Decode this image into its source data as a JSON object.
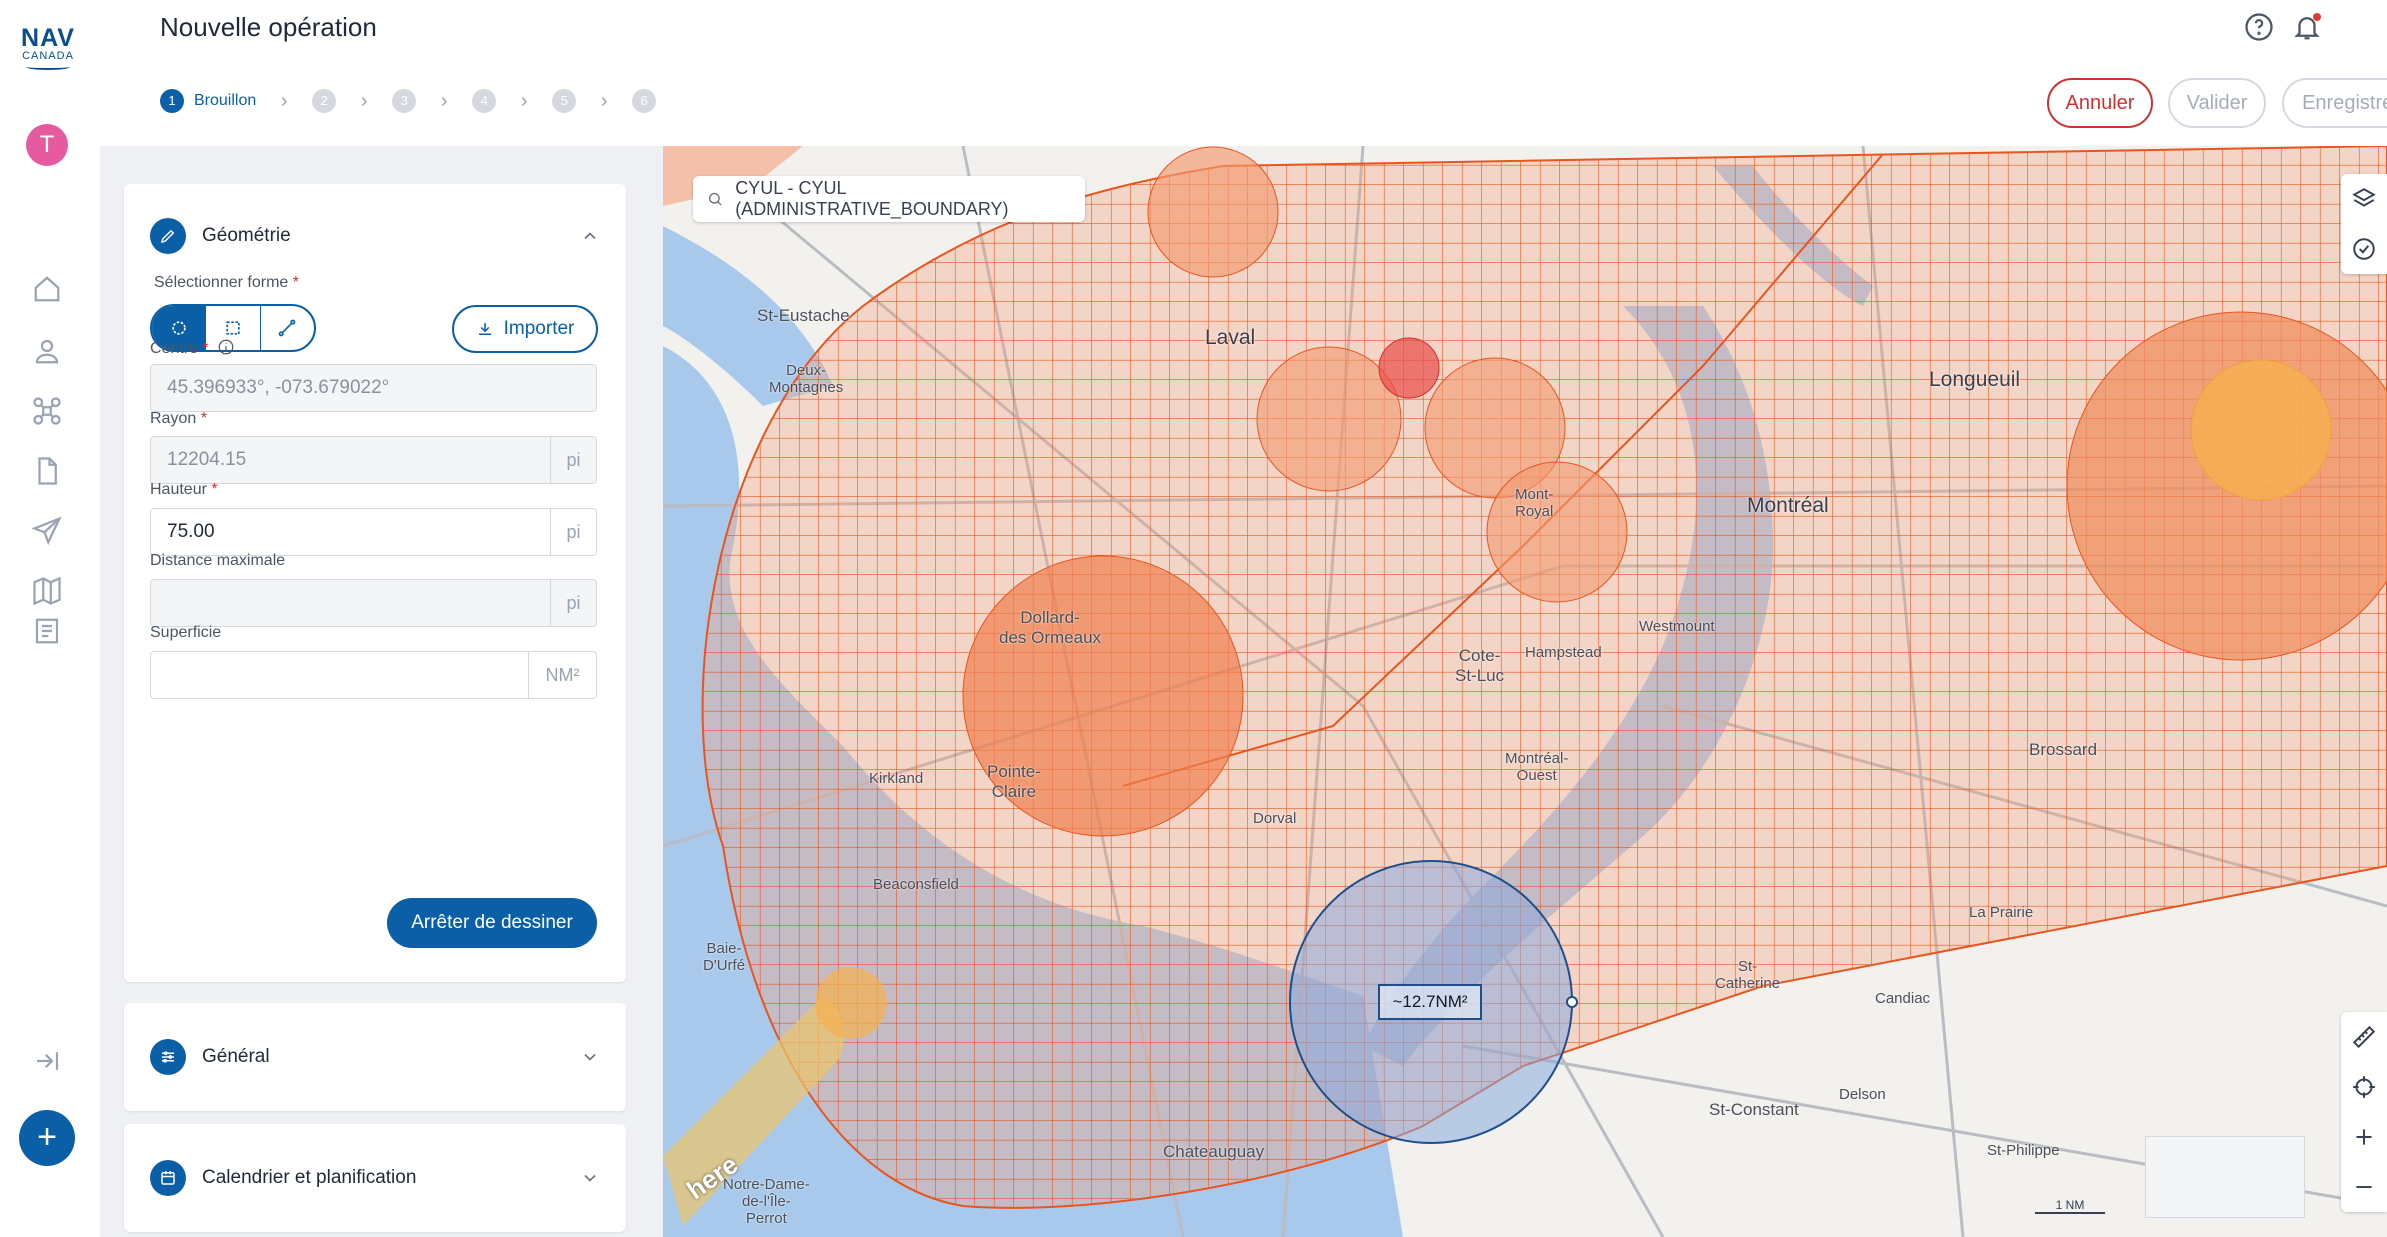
{
  "rail": {
    "logo_main": "NAV",
    "logo_sub": "CANADA",
    "avatar_letter": "T",
    "items": [
      "home-icon",
      "user-icon",
      "drone-icon",
      "document-icon",
      "send-icon",
      "map-icon",
      "logbook-icon"
    ],
    "collapse_icon": "collapse-icon",
    "add_label": "+"
  },
  "header": {
    "title": "Nouvelle opération",
    "help_icon": "help-icon",
    "bell_icon": "bell-icon",
    "steps": [
      {
        "number": "1",
        "label": "Brouillon",
        "active": true
      },
      {
        "number": "2",
        "label": "",
        "active": false
      },
      {
        "number": "3",
        "label": "",
        "active": false
      },
      {
        "number": "4",
        "label": "",
        "active": false
      },
      {
        "number": "5",
        "label": "",
        "active": false
      },
      {
        "number": "6",
        "label": "",
        "active": false
      }
    ],
    "buttons": {
      "cancel": "Annuler",
      "validate": "Valider",
      "save": "Enregistrer"
    }
  },
  "geometry": {
    "title": "Géométrie",
    "shape_label": "Sélectionner forme",
    "shape_options": [
      "circle",
      "rectangle",
      "polyline"
    ],
    "selected_shape": "circle",
    "import_label": "Importer",
    "center_label": "Centre",
    "center_value": "45.396933°, -073.679022°",
    "radius_label": "Rayon",
    "radius_value": "12204.15",
    "radius_unit": "pi",
    "height_label": "Hauteur",
    "height_value": "75.00",
    "height_unit": "pi",
    "max_distance_label": "Distance maximale",
    "max_distance_value": "",
    "max_distance_unit": "pi",
    "area_label": "Superficie",
    "area_value": "",
    "area_unit": "NM²",
    "stop_drawing": "Arrêter de dessiner",
    "required_mark": "*"
  },
  "sections": {
    "general": "Général",
    "calendar": "Calendrier et planification"
  },
  "map": {
    "search_value": "CYUL - CYUL (ADMINISTRATIVE_BOUNDARY)",
    "area_tag": "~12.7NM²",
    "tools": [
      "layers-icon",
      "check-circle-icon",
      "ruler-icon",
      "crosshair-icon",
      "zoom-in-icon",
      "zoom-out-icon"
    ],
    "scale_label": "1 NM",
    "logo": "here",
    "labels": {
      "laval": "Laval",
      "montreal": "Montréal",
      "longueuil": "Longueuil",
      "st_eustache": "St-Eustache",
      "deux_montagnes": "Deux-\nMontagnes",
      "dollard": "Dollard-\ndes Ormeaux",
      "pointe_claire": "Pointe-\nClaire",
      "kirkland": "Kirkland",
      "dorval": "Dorval",
      "cote_st_luc": "Cote-\nSt-Luc",
      "mont_royal": "Mont-\nRoyal",
      "westmount": "Westmount",
      "hampstead": "Hampstead",
      "brossard": "Brossard",
      "la_prairie": "La Prairie",
      "candiac": "Candiac",
      "st_constant": "St-Constant",
      "delson": "Delson",
      "st_philippe": "St-Philippe",
      "chateauguay": "Chateauguay",
      "beaconsfield": "Beaconsfield",
      "baie_durfe": "Baie-\nD'Urfé",
      "notre_dame": "Notre-Dame-\nde-l'Île-\nPerrot",
      "montreal_ouest": "Montréal-\nOuest",
      "st_catherine": "St-\nCatherine"
    }
  },
  "colors": {
    "brand": "#0a5fa6",
    "danger": "#d32f2f",
    "zone_fill": "#f6a07d",
    "zone_stroke": "#e8551e",
    "drawn_circle": "#4a76c2"
  }
}
